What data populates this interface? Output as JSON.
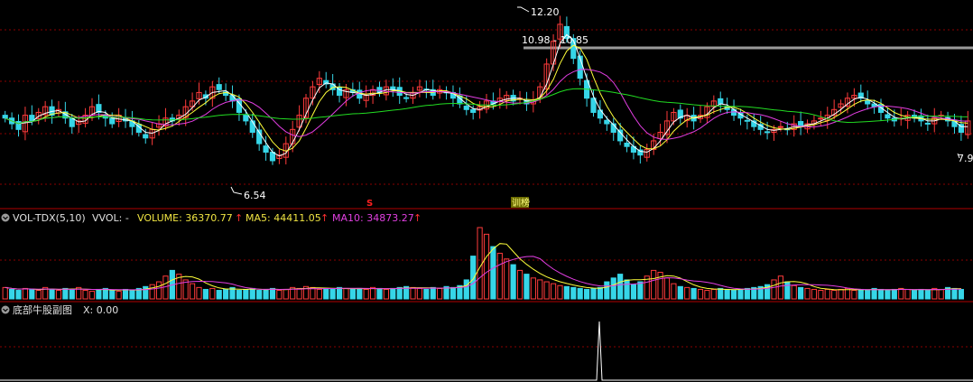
{
  "price_panel": {
    "high_label": "12.20",
    "low_label": "6.54",
    "right_label": "7.9",
    "range_label": "10.98 - 10.85",
    "marker_s": "S",
    "marker_tag": "训榜"
  },
  "volume_panel": {
    "indicator": "VOL-TDX(5,10)",
    "vvol_label": "VVOL: -",
    "volume_label": "VOLUME: 36370.77",
    "ma5_label": "MA5: 44411.05",
    "ma10_label": "MA10: 34873.27",
    "arrow": "↑"
  },
  "sub_panel": {
    "title": "底部牛股副图",
    "x_label": "X: 0.00"
  },
  "colors": {
    "up": "#ff3b3b",
    "down": "#36d6e8",
    "ma_white": "#ffffff",
    "ma_yellow": "#ffff3a",
    "ma_magenta": "#e23ee2",
    "ma_green": "#22dd22",
    "grid": "#8a0000",
    "separator": "#b00000",
    "label_yellow": "#f0e442",
    "label_magenta": "#e040e0"
  },
  "chart_data": {
    "type": "candlestick",
    "ylim": [
      6.3,
      12.4
    ],
    "high": 12.2,
    "low": 6.54,
    "last_close": 7.9,
    "resistance_range": [
      10.98,
      10.85
    ],
    "close": [
      8.5,
      8.3,
      8.1,
      8.6,
      8.4,
      8.7,
      8.9,
      8.6,
      8.8,
      8.5,
      8.2,
      8.4,
      8.6,
      8.9,
      8.7,
      8.5,
      8.3,
      8.6,
      8.4,
      8.2,
      8.0,
      7.8,
      8.1,
      8.3,
      8.5,
      8.4,
      8.6,
      8.9,
      9.1,
      9.4,
      9.2,
      9.6,
      9.5,
      9.3,
      9.1,
      8.7,
      8.4,
      8.0,
      7.6,
      7.3,
      7.0,
      7.2,
      7.6,
      8.1,
      8.6,
      9.2,
      9.6,
      9.9,
      9.7,
      9.5,
      9.3,
      9.5,
      9.4,
      9.2,
      9.3,
      9.5,
      9.4,
      9.6,
      9.5,
      9.3,
      9.2,
      9.4,
      9.6,
      9.5,
      9.3,
      9.5,
      9.4,
      9.2,
      9.0,
      8.8,
      8.7,
      8.9,
      9.1,
      9.0,
      9.2,
      9.3,
      9.1,
      9.2,
      9.0,
      9.1,
      9.6,
      10.4,
      11.2,
      11.8,
      11.3,
      10.6,
      9.9,
      9.2,
      8.7,
      8.5,
      8.3,
      8.0,
      7.7,
      7.5,
      7.3,
      7.2,
      7.4,
      7.7,
      8.0,
      8.4,
      8.7,
      8.5,
      8.6,
      8.4,
      8.6,
      8.9,
      9.1,
      9.0,
      8.8,
      8.6,
      8.5,
      8.4,
      8.2,
      8.1,
      8.0,
      8.1,
      8.2,
      8.1,
      8.3,
      8.2,
      8.3,
      8.4,
      8.5,
      8.6,
      8.8,
      9.0,
      9.2,
      9.3,
      9.2,
      9.0,
      8.9,
      8.7,
      8.5,
      8.4,
      8.5,
      8.6,
      8.5,
      8.4,
      8.3,
      8.5,
      8.6,
      8.4,
      8.2,
      8.0,
      8.4
    ],
    "volume": [
      12,
      10,
      9,
      11,
      10,
      9,
      12,
      10,
      9,
      11,
      10,
      12,
      9,
      8,
      10,
      11,
      9,
      8,
      10,
      9,
      11,
      13,
      15,
      18,
      24,
      30,
      26,
      20,
      16,
      12,
      10,
      11,
      9,
      10,
      12,
      9,
      10,
      11,
      9,
      10,
      11,
      9,
      10,
      12,
      11,
      13,
      12,
      10,
      11,
      10,
      12,
      11,
      10,
      11,
      10,
      12,
      11,
      10,
      11,
      12,
      13,
      12,
      11,
      10,
      12,
      11,
      13,
      12,
      14,
      20,
      45,
      75,
      68,
      55,
      48,
      42,
      36,
      30,
      26,
      22,
      20,
      18,
      16,
      14,
      13,
      12,
      11,
      10,
      11,
      12,
      18,
      22,
      26,
      20,
      15,
      18,
      24,
      30,
      28,
      22,
      16,
      13,
      12,
      11,
      10,
      9,
      10,
      11,
      10,
      9,
      10,
      11,
      12,
      13,
      15,
      20,
      24,
      18,
      14,
      12,
      11,
      10,
      9,
      10,
      9,
      10,
      11,
      9,
      10,
      9,
      11,
      10,
      9,
      10,
      11,
      10,
      9,
      10,
      9,
      11,
      10,
      12,
      11,
      10
    ],
    "sub_indicator": {
      "name": "底部牛股副图",
      "x": 0.0
    }
  }
}
